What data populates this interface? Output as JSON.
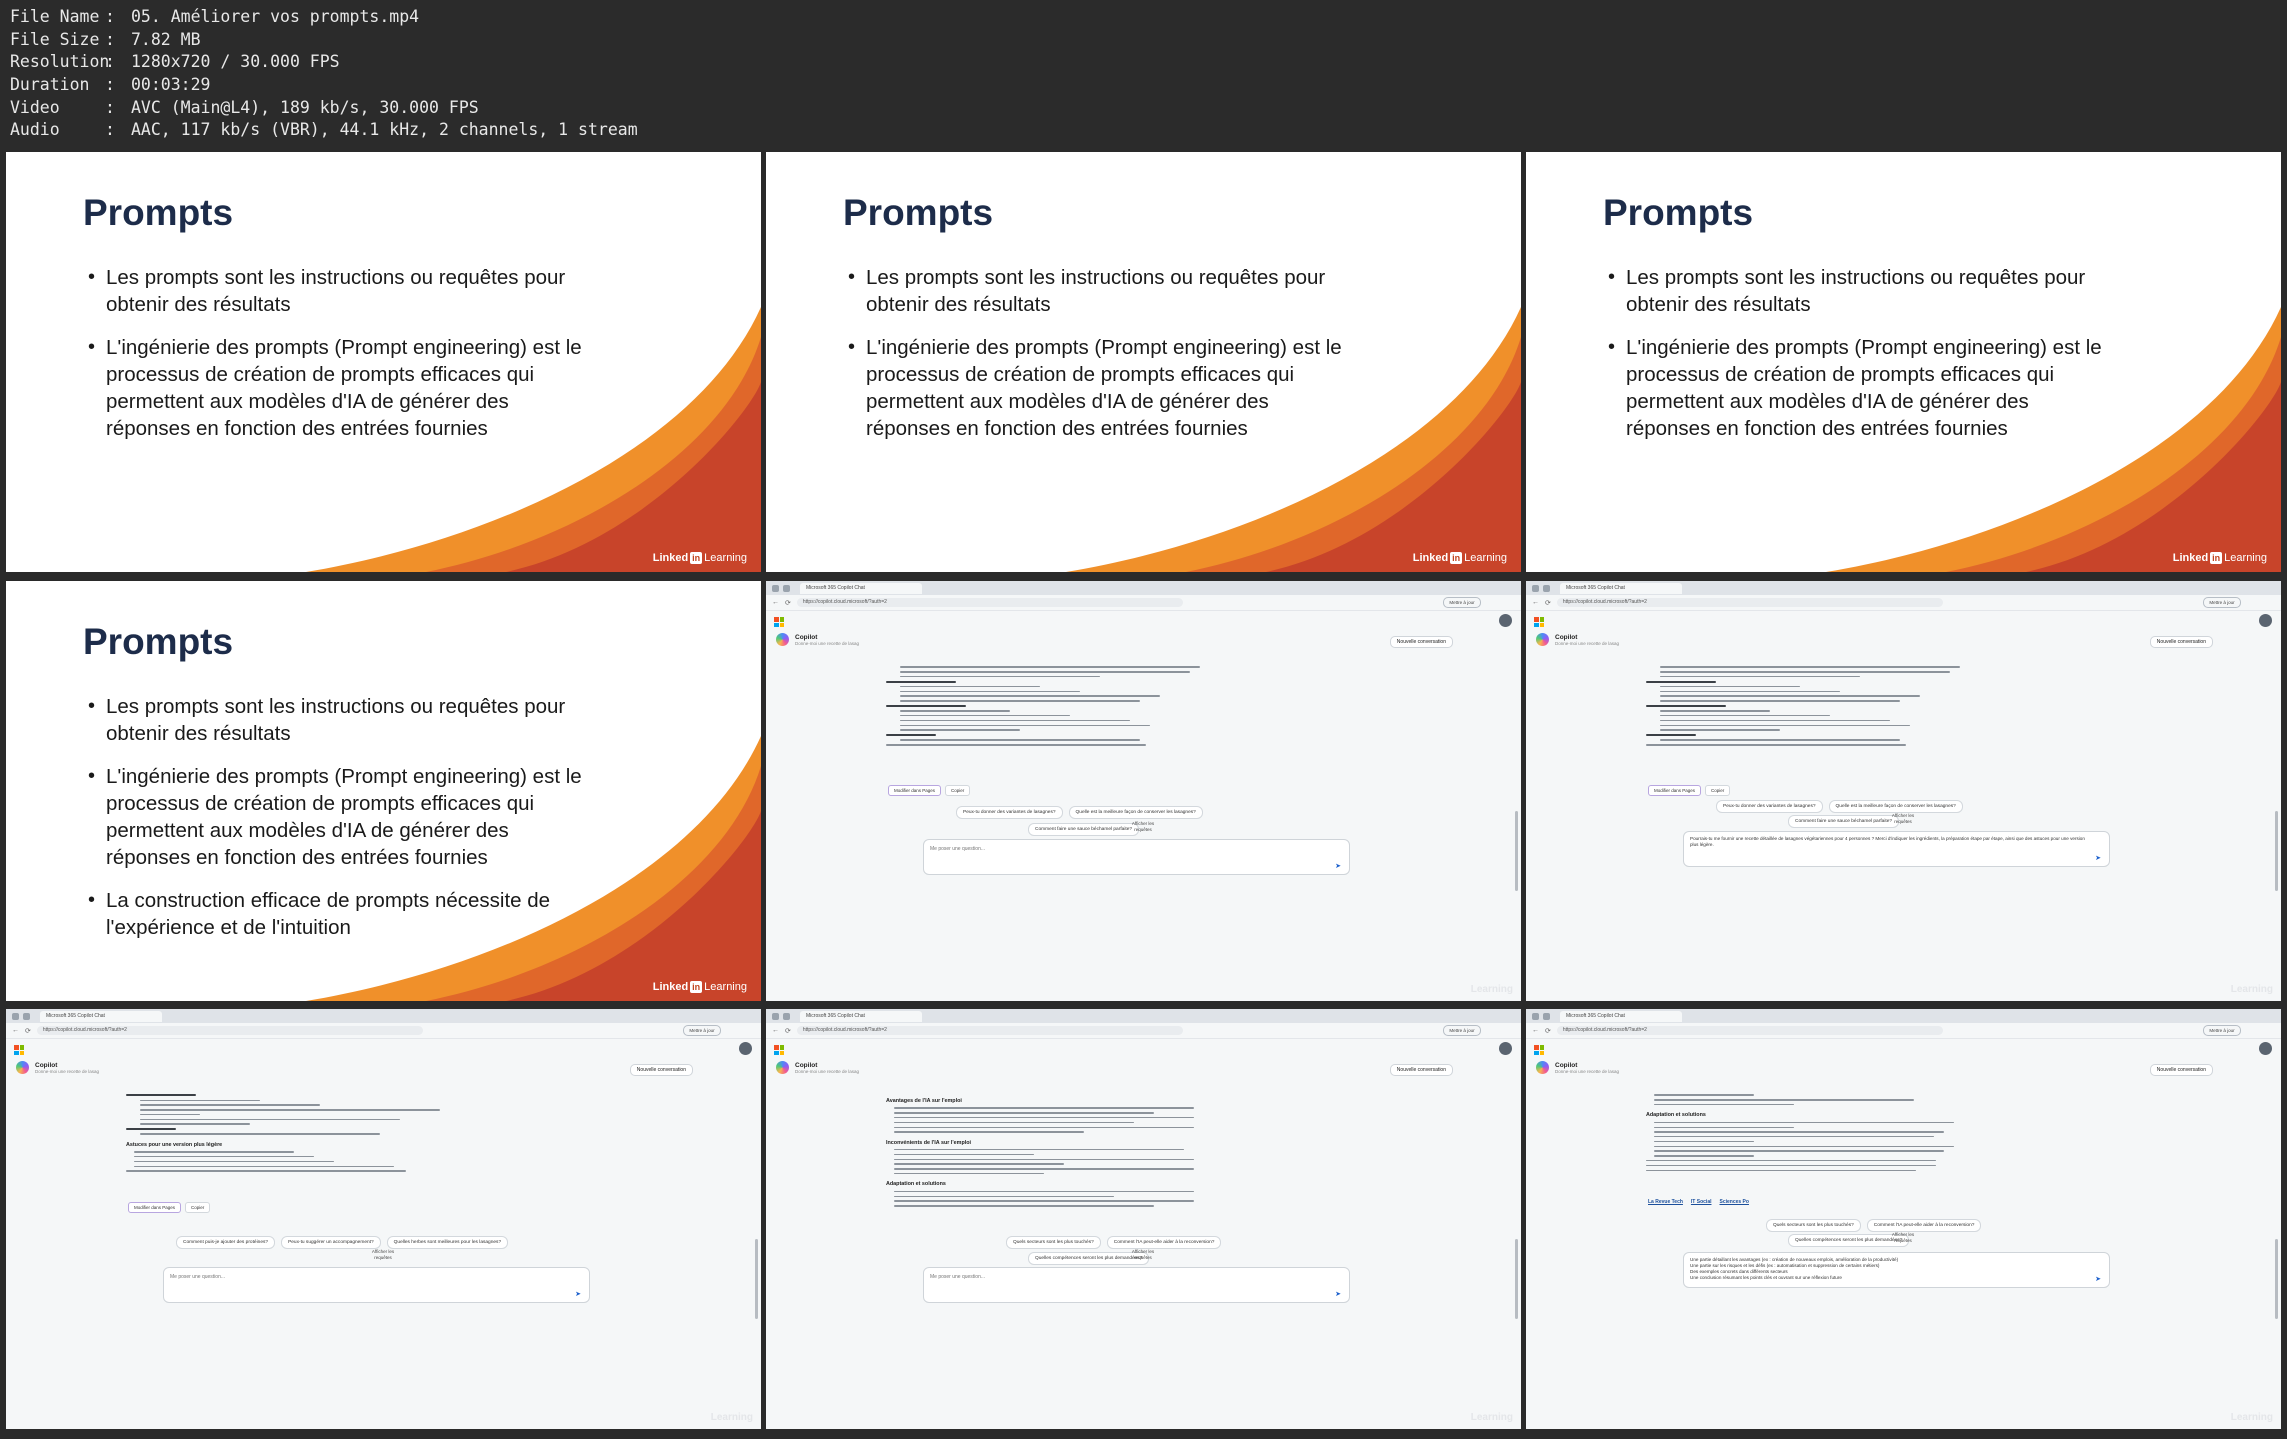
{
  "file_info": [
    {
      "key": "File Name",
      "value": "05. Améliorer vos prompts.mp4"
    },
    {
      "key": "File Size",
      "value": "7.82 MB"
    },
    {
      "key": "Resolution",
      "value": "1280x720 / 30.000 FPS"
    },
    {
      "key": "Duration",
      "value": "00:03:29"
    },
    {
      "key": "Video",
      "value": "AVC (Main@L4), 189 kb/s, 30.000 FPS"
    },
    {
      "key": "Audio",
      "value": "AAC, 117 kb/s (VBR), 44.1 kHz, 2 channels, 1 stream"
    }
  ],
  "separator": ":",
  "slide": {
    "title": "Prompts",
    "bullet_1": "Les prompts sont les instructions ou requêtes pour obtenir  des résultats",
    "bullet_2": "L'ingénierie des prompts (Prompt engineering) est le processus de création de prompts efficaces qui permettent aux modèles d'IA de générer des réponses en fonction des entrées fournies",
    "bullet_3": "La construction efficace de prompts nécessite de l'expérience et de l'intuition",
    "logo_brand": "Linked",
    "logo_in": "in",
    "logo_learning": "Learning"
  },
  "browser": {
    "tab_title": "Microsoft 365 Copilot Chat",
    "url": "https://copilot.cloud.microsoft/?auth=2",
    "update_button": "Mettre à jour",
    "copilot_name": "Copilot",
    "copilot_sub": "Donne-moi une recette de lasag",
    "new_conversation": "Nouvelle conversation",
    "modify_pages": "Modifier dans Pages",
    "copy": "Copier",
    "input_placeholder": "Me poser une question...",
    "show_requests": "Afficher les requêtes",
    "thumb5_suggestions": [
      "Peux-tu donner des variantes de lasagnes?",
      "Quelle est la meilleure façon de conserver les lasagnes?",
      "Comment faire une sauce béchamel parfaite?"
    ],
    "thumb6_input": "Pourrais-tu me fournir une recette détaillée de lasagnes végétariennes pour 4 personnes ? Merci d'indiquer les ingrédients, la préparation étape par étape, ainsi que des astuces pour une version plus légère.",
    "thumb7_heading": "Astuces pour une version plus légère",
    "thumb7_suggestions": [
      "Comment puis-je ajouter des protéines?",
      "Peux-tu suggérer un accompagnement?",
      "Quelles herbes sont meilleures pour les lasagnes?"
    ],
    "thumb8_heading_1": "Avantages de l'IA sur l'emploi",
    "thumb8_heading_2": "Inconvénients de l'IA sur l'emploi",
    "thumb8_heading_3": "Adaptation et solutions",
    "thumb8_suggestions": [
      "Quels secteurs sont les plus touchés?",
      "Comment l'IA peut-elle aider à la reconversion?",
      "Quelles compétences seront les plus demandées?"
    ],
    "thumb9_heading": "Adaptation et solutions",
    "thumb9_sources": [
      "La Revue Tech",
      "IT Social",
      "Sciences Po"
    ],
    "thumb9_suggestions": [
      "Quels secteurs sont les plus touchés?",
      "Comment l'IA peut-elle aider à la reconversion?",
      "Quelles compétences seront les plus demandées?"
    ],
    "thumb9_input": "Une partie détaillant les avantages (ex : création de nouveaux emplois, amélioration de la productivité)\nUne partie sur les risques et les défis (ex : automatisation et suppression de certains métiers)\nDes exemples concrets dans différents secteurs\nUne conclusion résumant les points clés et ouvrant sur une réflexion future"
  },
  "colors": {
    "title": "#1d2c4a",
    "swoosh_orange": "#f0902a",
    "swoosh_red": "#c8442a",
    "accent_blue": "#1b5fcc"
  }
}
